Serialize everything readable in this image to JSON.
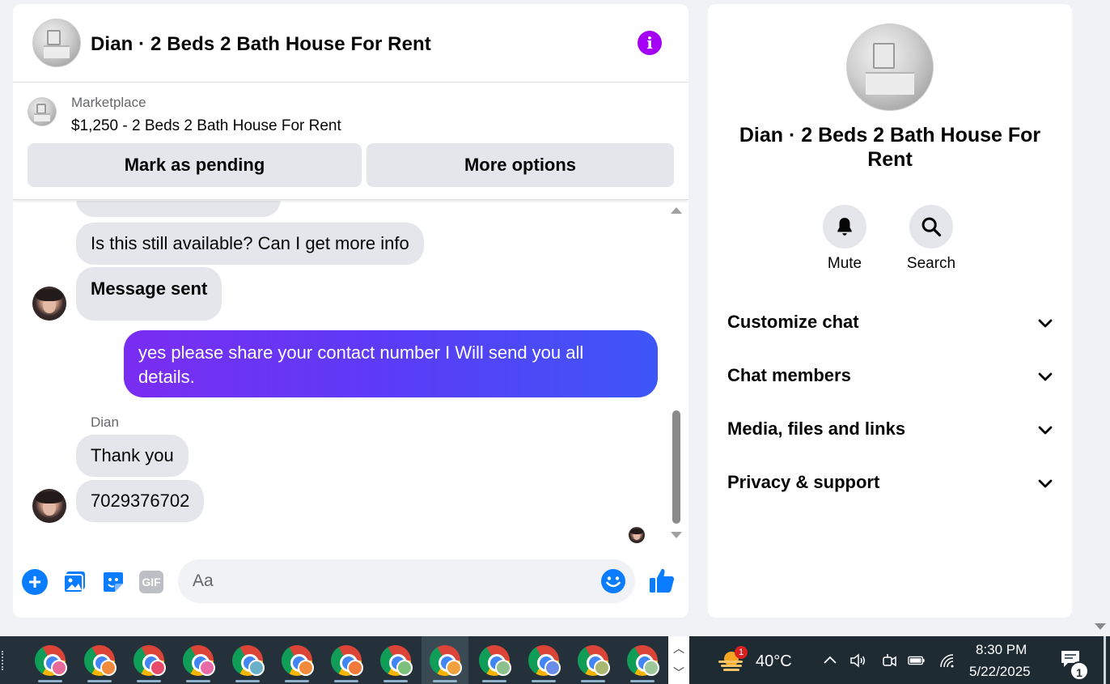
{
  "header": {
    "title": "Dian · 2 Beds 2 Bath House For Rent"
  },
  "listing": {
    "label": "Marketplace",
    "title": "$1,250 - 2 Beds 2 Bath House For Rent",
    "pending_button": "Mark as pending",
    "more_button": "More options"
  },
  "messages": {
    "available": "Is this still available? Can I get more info",
    "sent": "Message sent",
    "outgoing": "yes please share your contact number I Will send you all details.",
    "sender": "Dian",
    "thanks": "Thank you",
    "number": "7029376702"
  },
  "composer": {
    "placeholder": "Aa",
    "gif_label": "GIF"
  },
  "info": {
    "title": "Dian · 2 Beds 2 Bath House For Rent",
    "mute_label": "Mute",
    "search_label": "Search",
    "sections": [
      "Customize chat",
      "Chat members",
      "Media, files and links",
      "Privacy & support"
    ]
  },
  "taskbar": {
    "weather_badge": "1",
    "temperature": "40°C",
    "time": "8:30 PM",
    "date": "5/22/2025",
    "notification_count": "1"
  },
  "colors": {
    "accent_purple": "#a400f5",
    "outgoing_start": "#7a2df2",
    "outgoing_end": "#3d56f8",
    "messenger_blue": "#0a7cff"
  }
}
